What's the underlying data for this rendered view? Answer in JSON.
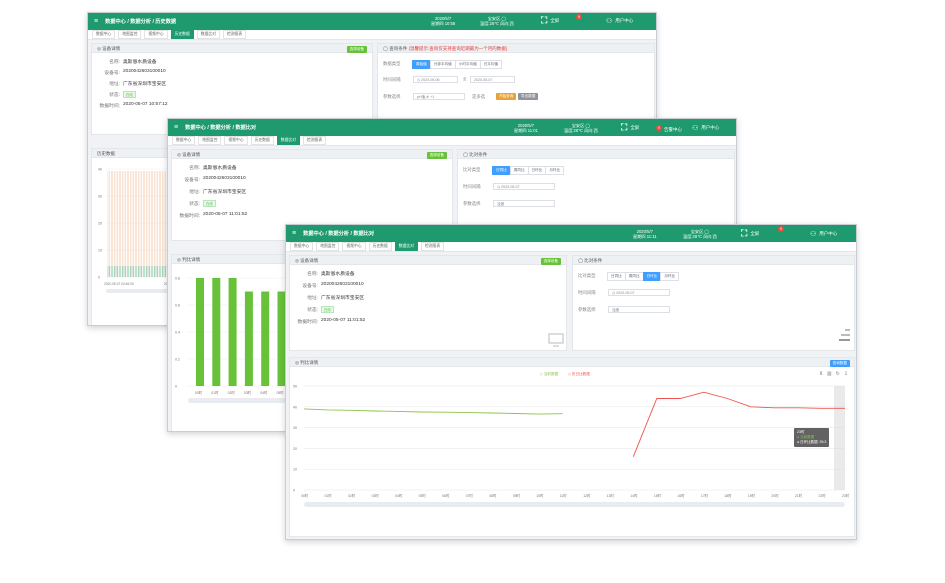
{
  "common": {
    "menu_icon": "≡",
    "breadcrumb_home": "数据中心",
    "breadcrumb_sep": "/",
    "breadcrumb_mid": "数据分析",
    "fullscreen_label": "全屏",
    "user_center_label": "用户中心",
    "tab_sep": "×"
  },
  "win1": {
    "breadcrumb_page": "历史数据",
    "date": "2020/5/7",
    "time": "星期四 10:58",
    "weather_place": "宝安区 ◯",
    "weather_info": "温度:28℃ 风向:西",
    "alarm_count": "9",
    "alarm_label": "告警",
    "tabs": [
      "数据中心",
      "地图监控",
      "视频中心",
      "历史数据",
      "数据比对",
      "检测报表"
    ],
    "active_tab": 3,
    "device_title": "◎ 设备详情",
    "select_device": "选择设备",
    "fields": [
      {
        "k": "名称:",
        "v": "奥斯恩水质设备"
      },
      {
        "k": "设备号:",
        "v": "2020042603100010"
      },
      {
        "k": "地址:",
        "v": "广东省深圳市宝安区"
      },
      {
        "k": "状态:",
        "v": "在线"
      },
      {
        "k": "数据时间:",
        "v": "2020-05-07 10:57:12"
      }
    ],
    "query_title": "◯ 查询条件",
    "query_note": "(温馨提示:查询仅支持查询近期最为一个月的数据)",
    "data_type_label": "数据类型",
    "data_types": [
      "原始值",
      "分钟平均值",
      "小时平均值",
      "日平均值"
    ],
    "time_label": "时间间隔",
    "time_from": "2020-05-06",
    "time_sep": "至",
    "time_to": "2020-05-07",
    "param_label": "参数选择",
    "param_value": "pH值 ⊗  +1",
    "multi_label": "是多选",
    "search_btn": "开始查询",
    "export_btn": "导出数据",
    "history_title": "历史数据",
    "y_ticks": [
      "40",
      "30",
      "20",
      "10",
      "0"
    ],
    "x_ticks": [
      "2020-05-07 02:46:30",
      "2020-05-07"
    ]
  },
  "win2": {
    "breadcrumb_page": "数据比对",
    "date": "2020/5/7",
    "time": "星期四 11:01",
    "weather_place": "宝安区 ◯",
    "weather_info": "温度:28℃ 风向:西",
    "alarm_count": "9",
    "alarm_label": "告警中心",
    "tabs": [
      "数据中心",
      "地图监控",
      "视频中心",
      "历史数据",
      "数据比对",
      "检测报表"
    ],
    "active_tab": 4,
    "device_title": "◎ 设备详情",
    "select_device": "选择设备",
    "fields": [
      {
        "k": "名称:",
        "v": "奥斯恩水质设备"
      },
      {
        "k": "设备号:",
        "v": "2020042603100010"
      },
      {
        "k": "地址:",
        "v": "广东省深圳市宝安区"
      },
      {
        "k": "状态:",
        "v": "在线"
      },
      {
        "k": "数据时间:",
        "v": "2020-05-07 11:01:52"
      }
    ],
    "compare_title": "◯ 比对条件",
    "compare_type_label": "比对类型",
    "compare_types": [
      "日同比",
      "周同比",
      "日环比",
      "月环比"
    ],
    "time_label": "时间间隔",
    "time_value": "◷ 2020-05-07",
    "param_label": "参数选择",
    "param_value": "浊度",
    "chart_title": "◎ 判比详情",
    "chart_data": {
      "type": "bar",
      "categories": [
        "00时",
        "01时",
        "02时",
        "03时",
        "04时",
        "05时"
      ],
      "values": [
        0.8,
        0.8,
        0.8,
        0.7,
        0.7,
        0.7
      ],
      "ylim": [
        0,
        0.8
      ],
      "yticks": [
        "0.8",
        "0.6",
        "0.4",
        "0.2",
        "0"
      ],
      "color": "#67c23a"
    }
  },
  "win3": {
    "breadcrumb_page": "数据比对",
    "date": "2020/5/7",
    "time": "星期四 11:11",
    "weather_place": "宝安区 ◯",
    "weather_info": "温度:28℃ 风向:西",
    "alarm_count": "9",
    "alarm_label": "",
    "tabs": [
      "数据中心",
      "地图监控",
      "视频中心",
      "历史数据",
      "数据比对",
      "检测报表"
    ],
    "active_tab": 4,
    "device_title": "◎ 设备详情",
    "select_device": "选择设备",
    "fields": [
      {
        "k": "名称:",
        "v": "奥斯恩水质设备"
      },
      {
        "k": "设备号:",
        "v": "2020042603100010"
      },
      {
        "k": "地址:",
        "v": "广东省深圳市宝安区"
      },
      {
        "k": "状态:",
        "v": "在线"
      },
      {
        "k": "数据时间:",
        "v": "2020-05-07 11:01:52"
      }
    ],
    "compare_title": "◯ 比对条件",
    "compare_type_label": "比对类型",
    "compare_types": [
      "日同比",
      "周同比",
      "日环比",
      "月环比"
    ],
    "active_compare": 2,
    "time_label": "时间间隔",
    "time_value": "◷ 2020-05-07",
    "param_label": "参数选择",
    "param_value": "浊度",
    "chart_title": "◎ 判比详情",
    "compare_btn": "查询数据",
    "legend": [
      "◇ 当前数据",
      "◇ 历日比数据"
    ],
    "tooltip": {
      "title": "23时",
      "line1": "● 当前数据",
      "line2": "● 日环比数据: 39.3"
    },
    "chart_data": {
      "type": "line",
      "x": [
        "00时",
        "01时",
        "02时",
        "03时",
        "04时",
        "05时",
        "06时",
        "07时",
        "08时",
        "09时",
        "10时",
        "11时",
        "12时",
        "13时",
        "14时",
        "15时",
        "16时",
        "17时",
        "18时",
        "19时",
        "20时",
        "21时",
        "22时",
        "23时"
      ],
      "yticks": [
        "50",
        "40",
        "30",
        "20",
        "10",
        "0"
      ],
      "ylim": [
        0,
        50
      ],
      "series": [
        {
          "name": "当前数据",
          "color": "#8bc34a",
          "values": [
            39,
            38.5,
            38.3,
            38,
            37.8,
            37.5,
            37.4,
            37.2,
            37,
            36.8,
            36.5,
            36.7,
            null,
            null,
            null,
            null,
            null,
            null,
            null,
            null,
            null,
            null,
            null,
            null
          ]
        },
        {
          "name": "日环比数据",
          "color": "#ef5350",
          "values": [
            null,
            null,
            null,
            null,
            null,
            null,
            null,
            null,
            null,
            null,
            null,
            null,
            null,
            null,
            16,
            44,
            44,
            47,
            44,
            40,
            39.5,
            39.5,
            39.3,
            39.3
          ]
        }
      ]
    }
  }
}
